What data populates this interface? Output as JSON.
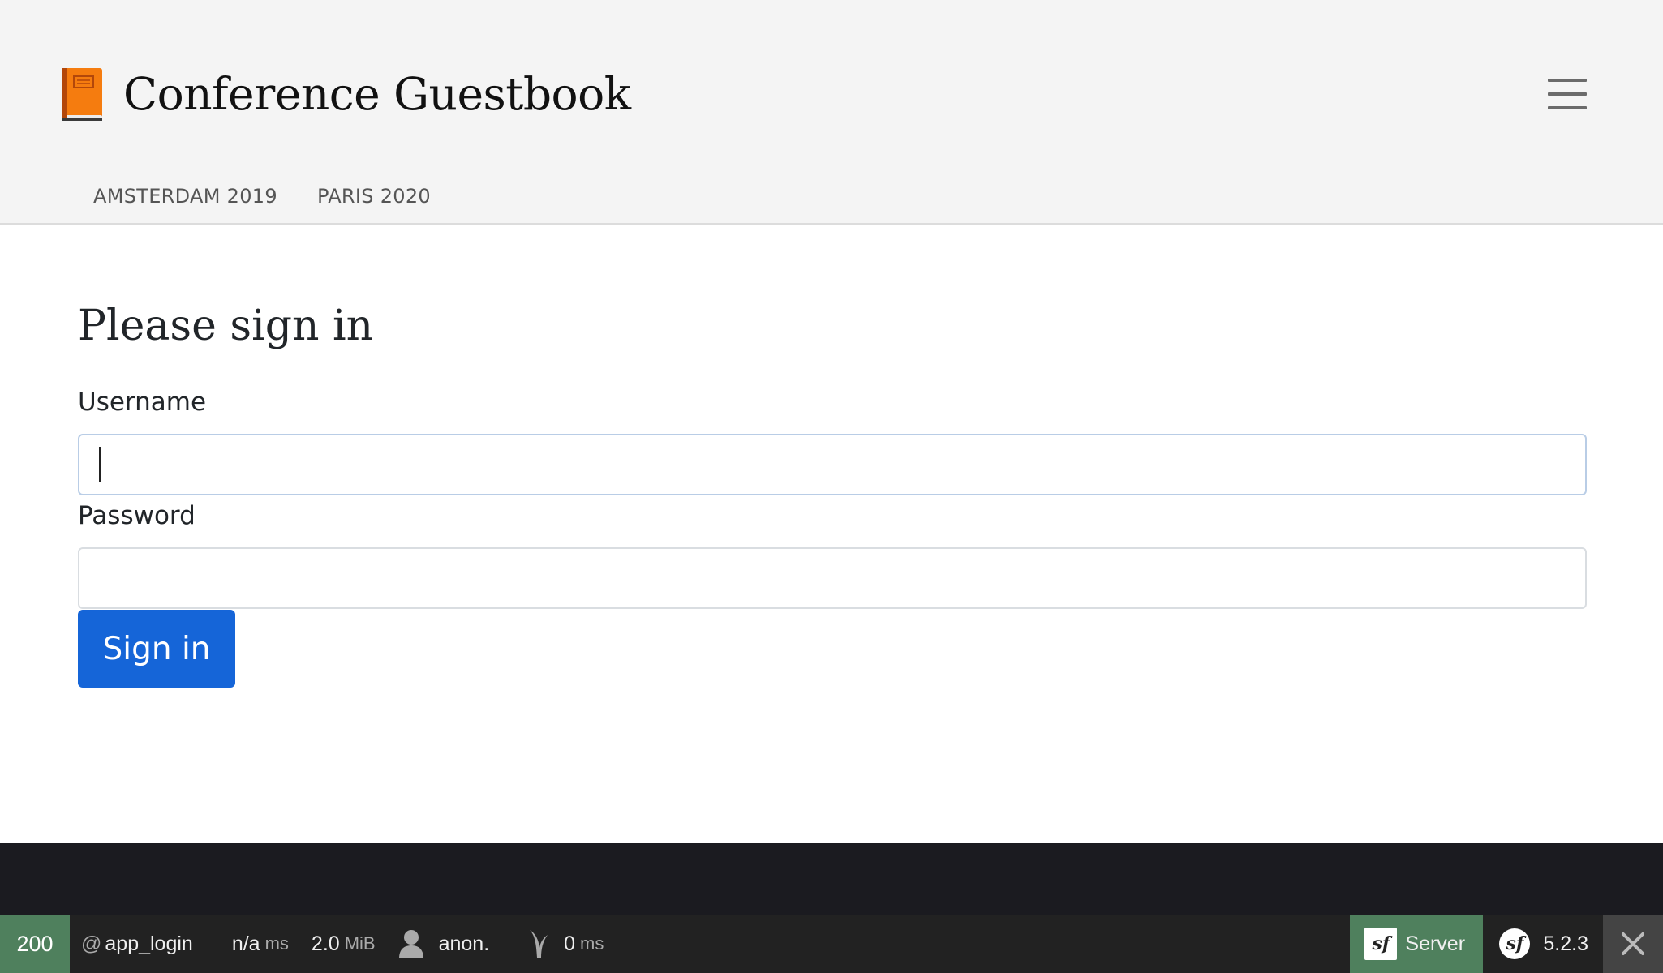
{
  "header": {
    "title": "Conference Guestbook",
    "logo_icon": "closed-book-icon",
    "menu_icon": "hamburger-icon",
    "nav": [
      {
        "label": "AMSTERDAM 2019"
      },
      {
        "label": "PARIS 2020"
      }
    ]
  },
  "form": {
    "title": "Please sign in",
    "username_label": "Username",
    "username_value": "",
    "password_label": "Password",
    "password_value": "",
    "submit_label": "Sign in"
  },
  "toolbar": {
    "status_code": "200",
    "route_prefix": "@",
    "route": "app_login",
    "time_value": "n/a",
    "time_unit": "ms",
    "memory_value": "2.0",
    "memory_unit": "MiB",
    "user": "anon.",
    "events_value": "0",
    "events_unit": "ms",
    "server_label": "Server",
    "version": "5.2.3",
    "status_color": "#4f805d",
    "accent_color": "#1565d8"
  }
}
